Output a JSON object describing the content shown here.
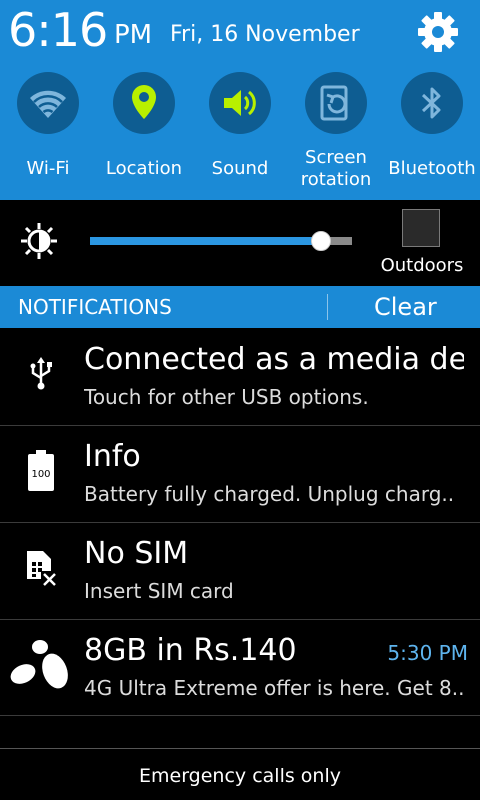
{
  "status": {
    "time": "6:16",
    "ampm": "PM",
    "date": "Fri, 16 November"
  },
  "toggles": [
    {
      "label": "Wi-Fi",
      "icon": "wifi-icon",
      "active": false
    },
    {
      "label": "Location",
      "icon": "location-pin-icon",
      "active": true,
      "color": "#b8f000"
    },
    {
      "label": "Sound",
      "icon": "speaker-icon",
      "active": true,
      "color": "#b8f000"
    },
    {
      "label": "Screen rotation",
      "icon": "rotation-icon",
      "active": false
    },
    {
      "label": "Bluetooth",
      "icon": "bluetooth-icon",
      "active": false
    }
  ],
  "brightness": {
    "level": 0.88,
    "outdoors_label": "Outdoors"
  },
  "notifications_header": {
    "title": "NOTIFICATIONS",
    "clear_label": "Clear"
  },
  "notifications": [
    {
      "icon": "usb-icon",
      "title": "Connected as a media de..",
      "subtitle": "Touch for other USB options.",
      "time": ""
    },
    {
      "icon": "battery-icon",
      "icon_text": "100",
      "title": "Info",
      "subtitle": "Battery fully charged. Unplug charg..",
      "time": ""
    },
    {
      "icon": "no-sim-icon",
      "title": "No SIM",
      "subtitle": "Insert SIM card",
      "time": ""
    },
    {
      "icon": "carrier-logo-icon",
      "title": "8GB in Rs.140",
      "subtitle": "4G Ultra Extreme offer is here. Get 8..",
      "time": "5:30 PM"
    }
  ],
  "footer": {
    "emergency_text": "Emergency calls only"
  },
  "colors": {
    "panel_blue": "#1b8ad6",
    "circle_blue": "#0e5d92",
    "active_green": "#b8f000",
    "time_blue": "#5eb4ee"
  }
}
